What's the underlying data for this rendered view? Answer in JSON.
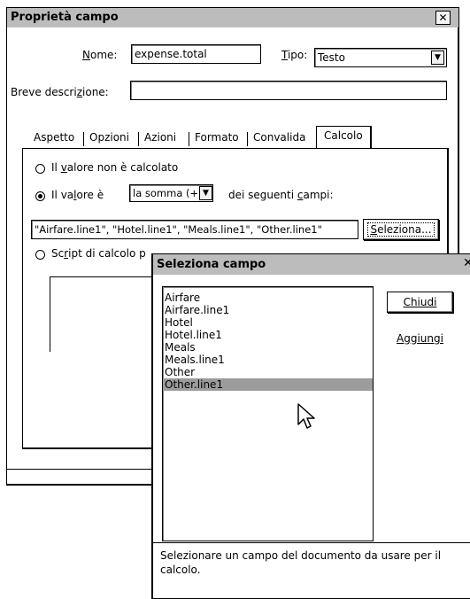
{
  "main_dialog": {
    "title": "Proprietà campo",
    "name_label": "Nome:",
    "name_value": "expense.total",
    "type_label": "Tipo:",
    "type_value": "Testo",
    "short_desc_label": "Breve descrizione:",
    "short_desc_value": "",
    "tabs": [
      "Aspetto",
      "Opzioni",
      "Azioni",
      "Formato",
      "Convalida",
      "Calcolo"
    ],
    "active_tab": "Calcolo",
    "calc": {
      "option_not_calculated": "Il valore non è calcolato",
      "option_value_is": "Il valore è",
      "operation_value": "la somma (+",
      "fields_suffix": "dei seguenti campi:",
      "fields_value": "\"Airfare.line1\", \"Hotel.line1\", \"Meals.line1\", \"Other.line1\"",
      "select_button": "Seleziona...",
      "option_script": "Script di calcolo p"
    }
  },
  "select_dialog": {
    "title": "Seleziona campo",
    "items": [
      "Airfare",
      "Airfare.line1",
      "Hotel",
      "Hotel.line1",
      "Meals",
      "Meals.line1",
      "Other",
      "Other.line1"
    ],
    "selected_item": "Other.line1",
    "close_button": "Chiudi",
    "add_button": "Aggiungi",
    "hint": "Selezionare un campo del documento da usare per il calcolo."
  }
}
